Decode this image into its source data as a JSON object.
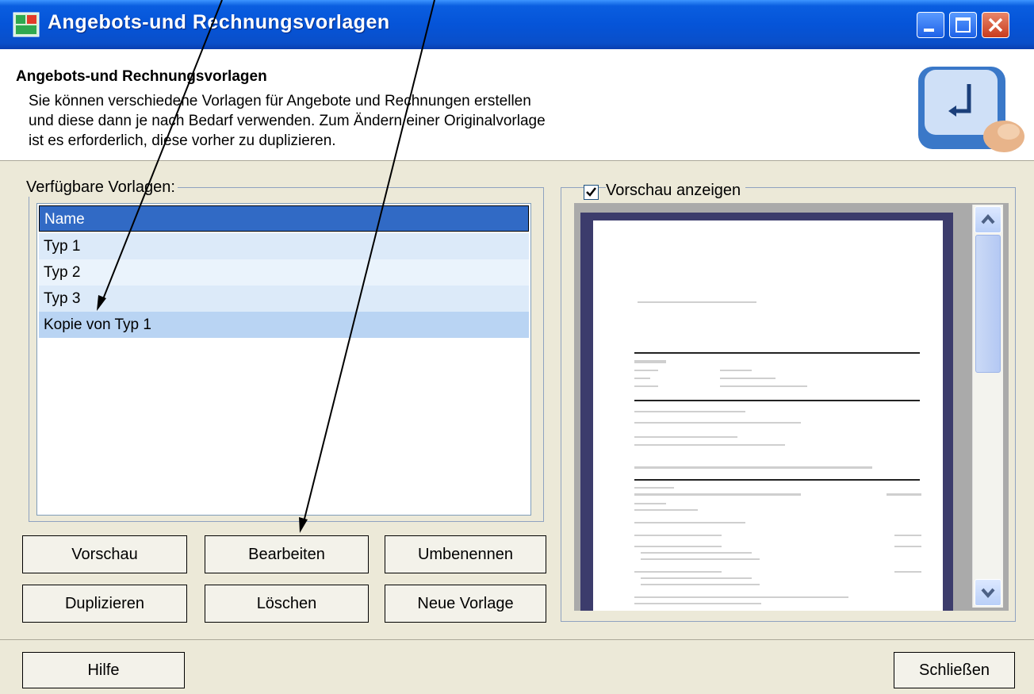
{
  "window": {
    "title": "Angebots-und Rechnungsvorlagen",
    "controls": [
      "minimize-icon",
      "maximize-icon",
      "close-icon"
    ]
  },
  "header": {
    "title": "Angebots-und Rechnungsvorlagen",
    "description": [
      "Sie können verschiedene Vorlagen für Angebote und Rechnungen erstellen",
      "und diese dann je nach Bedarf verwenden. Zum Ändern einer Originalvorlage",
      "ist es erforderlich, diese vorher zu duplizieren."
    ]
  },
  "templates": {
    "legend": "Verfügbare Vorlagen:",
    "column_header": "Name",
    "items": [
      "Typ 1",
      "Typ 2",
      "Typ 3",
      "Kopie von Typ 1"
    ],
    "selected_index": 3
  },
  "preview": {
    "checkbox_label": "Vorschau anzeigen",
    "checked": true
  },
  "actions": {
    "preview": "Vorschau",
    "edit": "Bearbeiten",
    "rename": "Umbenennen",
    "duplicate": "Duplizieren",
    "delete": "Löschen",
    "new_template": "Neue Vorlage"
  },
  "footer": {
    "help": "Hilfe",
    "close": "Schließen"
  },
  "colors": {
    "titlebar": "#0554d8",
    "selection": "#316ac5",
    "row_light": "#dceaf9",
    "row_selected": "#b9d4f3",
    "dialog_bg": "#ece9d8"
  }
}
